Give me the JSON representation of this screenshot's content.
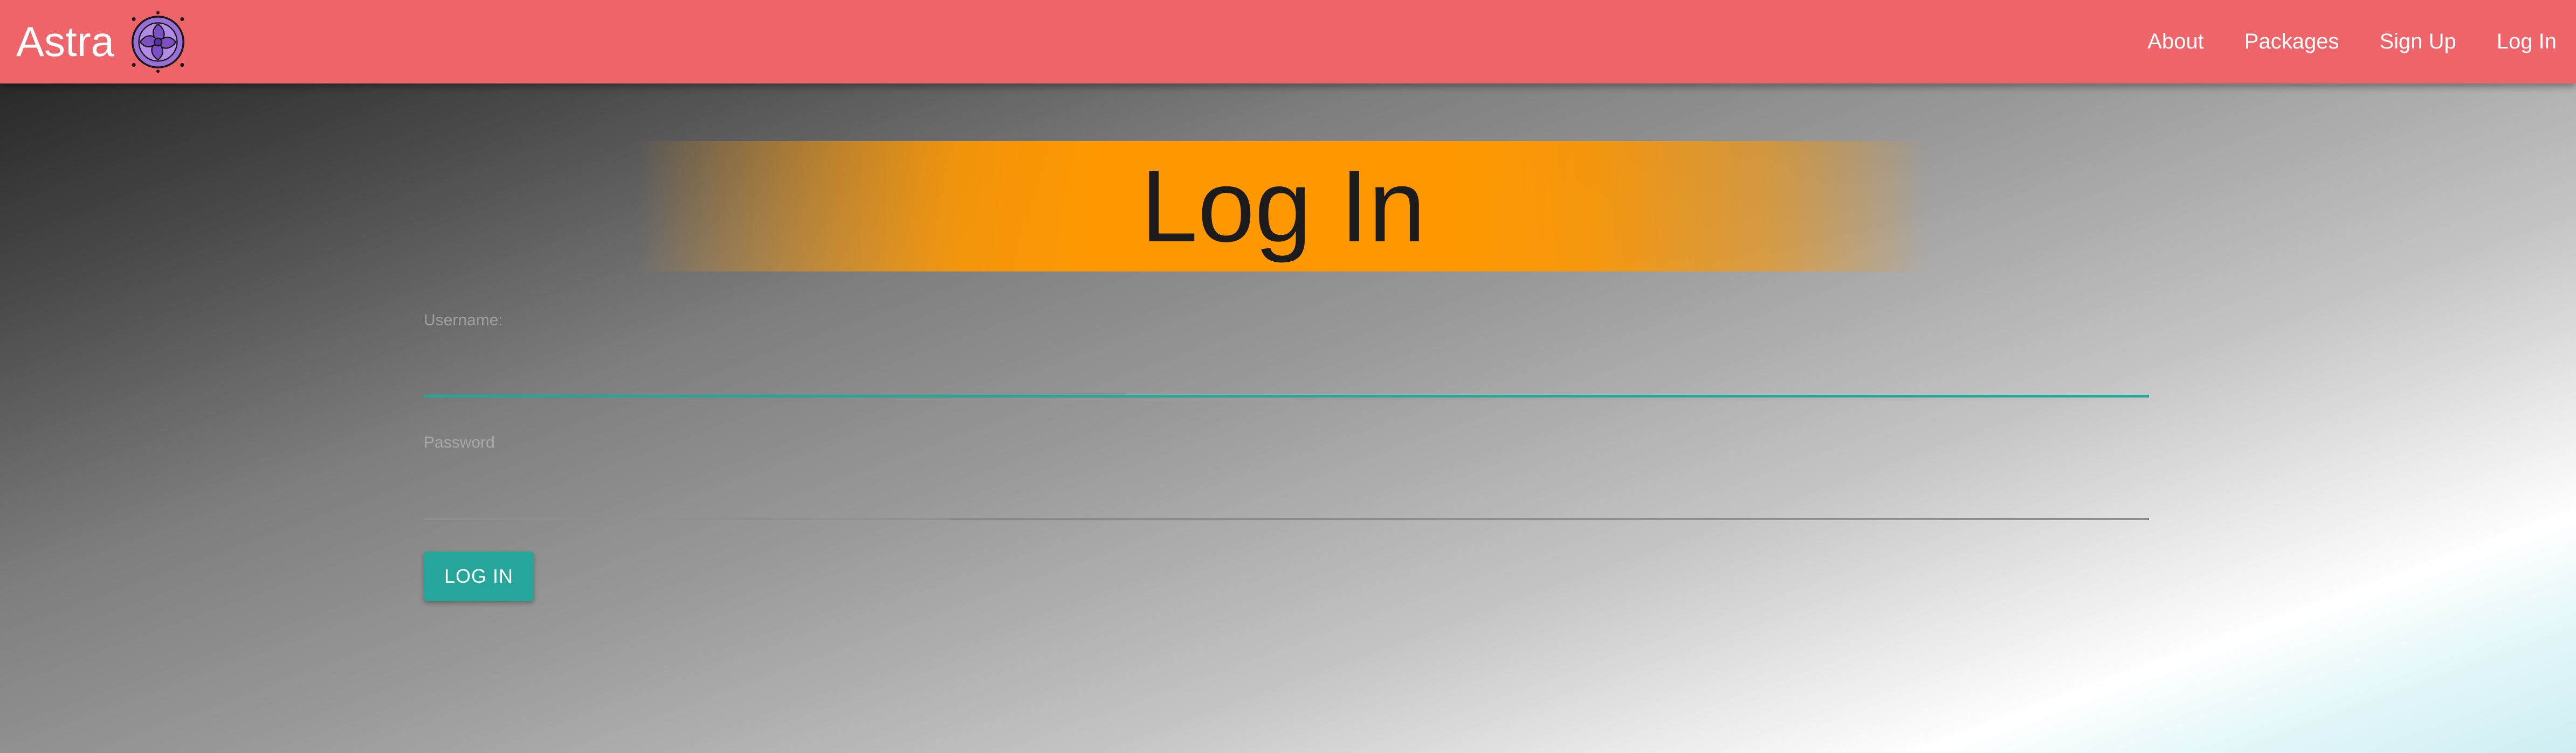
{
  "navbar": {
    "brand": "Astra",
    "logo_icon": "astra-flower-icon",
    "background_color": "#ee6469",
    "links": [
      {
        "label": "About"
      },
      {
        "label": "Packages"
      },
      {
        "label": "Sign Up"
      },
      {
        "label": "Log In"
      }
    ]
  },
  "page": {
    "title": "Log In",
    "banner_color": "#ff9800"
  },
  "form": {
    "username": {
      "label": "Username:",
      "value": "",
      "placeholder": ""
    },
    "password": {
      "label": "Password",
      "value": "",
      "placeholder": ""
    },
    "submit_label": "LOG IN",
    "accent_color": "#26a69a"
  }
}
